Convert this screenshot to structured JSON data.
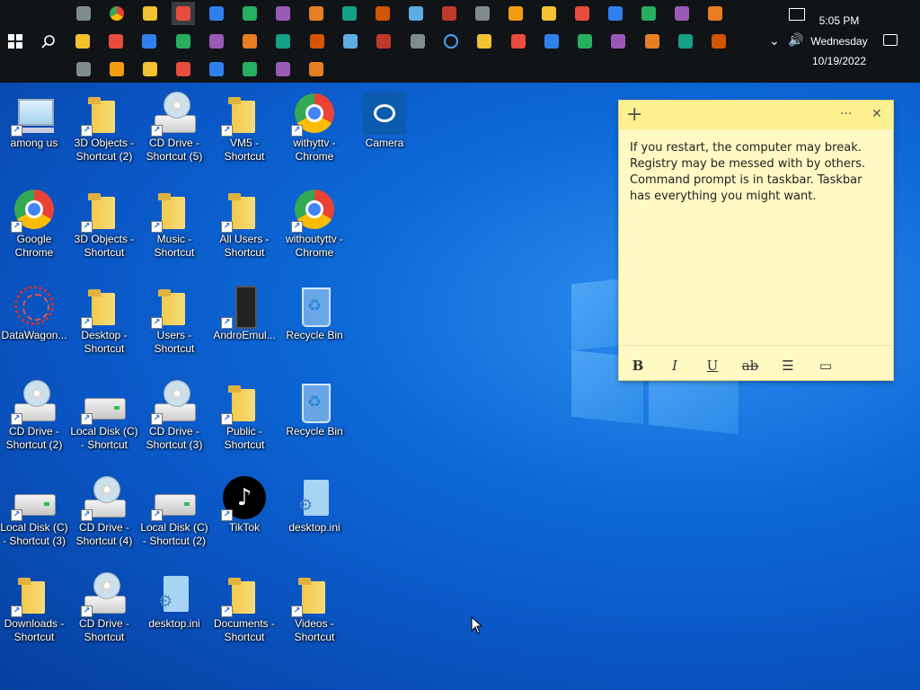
{
  "taskbar": {
    "clock_time": "5:05 PM",
    "clock_day": "Wednesday",
    "clock_date": "10/19/2022",
    "icons_row1": [
      "file-explorer-icon",
      "chrome-icon",
      "photos-icon",
      "sticky-notes-icon",
      "settings-icon",
      "paint3d-icon",
      "ie-icon",
      "draw-icon",
      "notepad-icon",
      "paint-icon",
      "remote-desktop-icon",
      "snip-icon",
      "weather-icon",
      "store-icon",
      "calendar-icon",
      "print-icon",
      "media-player-icon",
      "word-icon",
      "cortana-icon",
      "network-icon"
    ],
    "icons_row2": [
      "start-icon",
      "search-icon",
      "office-icon",
      "drive-icon",
      "notebook-icon",
      "magnifier-icon",
      "task-icon",
      "scanner-icon",
      "keyboard-icon",
      "clock-icon",
      "printer-icon",
      "cmd-icon",
      "monitor-icon",
      "circle-icon",
      "calculator-icon",
      "camera-icon",
      "firefox-icon",
      "edge-icon",
      "clipboard-icon",
      "gear-icon",
      "shield-icon",
      "battery-icon"
    ],
    "icons_row3": [
      "powershell-icon",
      "powershell-ise-icon",
      "terminal-icon",
      "powershell-x86-icon",
      "store-grid-icon",
      "teams-icon",
      "tiktok-icon",
      "roblox-icon"
    ]
  },
  "desktop": {
    "icons": [
      {
        "label": "among us",
        "type": "pc"
      },
      {
        "label": "3D Objects - Shortcut (2)",
        "type": "folder"
      },
      {
        "label": "CD Drive - Shortcut (5)",
        "type": "cd"
      },
      {
        "label": "VM5 - Shortcut",
        "type": "folder"
      },
      {
        "label": "withyttv - Chrome",
        "type": "chrome"
      },
      {
        "label": "Camera",
        "type": "camera"
      },
      {
        "label": "Google Chrome",
        "type": "chrome"
      },
      {
        "label": "3D Objects - Shortcut",
        "type": "folder"
      },
      {
        "label": "Music - Shortcut",
        "type": "folder"
      },
      {
        "label": "All Users - Shortcut",
        "type": "folder"
      },
      {
        "label": "withoutyttv - Chrome",
        "type": "chrome"
      },
      {
        "label": "DataWagon...",
        "type": "dwagon"
      },
      {
        "label": "Desktop - Shortcut",
        "type": "folder"
      },
      {
        "label": "Users - Shortcut",
        "type": "folder"
      },
      {
        "label": "AndroEmul...",
        "type": "phone"
      },
      {
        "label": "Recycle Bin",
        "type": "bin"
      },
      {
        "label": "CD Drive - Shortcut (2)",
        "type": "cd"
      },
      {
        "label": "Local Disk (C) - Shortcut",
        "type": "disk"
      },
      {
        "label": "CD Drive - Shortcut (3)",
        "type": "cd"
      },
      {
        "label": "Public - Shortcut",
        "type": "folder"
      },
      {
        "label": "Recycle Bin",
        "type": "bin"
      },
      {
        "label": "Local Disk (C) - Shortcut (3)",
        "type": "disk"
      },
      {
        "label": "CD Drive - Shortcut (4)",
        "type": "cd"
      },
      {
        "label": "Local Disk (C) - Shortcut (2)",
        "type": "disk"
      },
      {
        "label": "TikTok",
        "type": "tiktok"
      },
      {
        "label": "desktop.ini",
        "type": "file"
      },
      {
        "label": "Downloads - Shortcut",
        "type": "folder"
      },
      {
        "label": "CD Drive - Shortcut",
        "type": "cd"
      },
      {
        "label": "desktop.ini",
        "type": "file"
      },
      {
        "label": "Documents - Shortcut",
        "type": "folder"
      },
      {
        "label": "Videos - Shortcut",
        "type": "folder"
      }
    ]
  },
  "sticky_note": {
    "text": "If you restart, the computer may break. Registry may be messed with by others. Command prompt is in taskbar. Taskbar has everything you might want.",
    "add_label": "+",
    "menu_label": "···",
    "close_label": "✕",
    "toolbar": {
      "bold": "B",
      "italic": "I",
      "underline": "U",
      "strike": "ab",
      "list": "☰",
      "image": "▭"
    }
  },
  "colors": {
    "taskbar": "#111417",
    "note_body": "#fff9c4",
    "note_header": "#fdf08f",
    "desktop_accent": "#0a55c4"
  }
}
